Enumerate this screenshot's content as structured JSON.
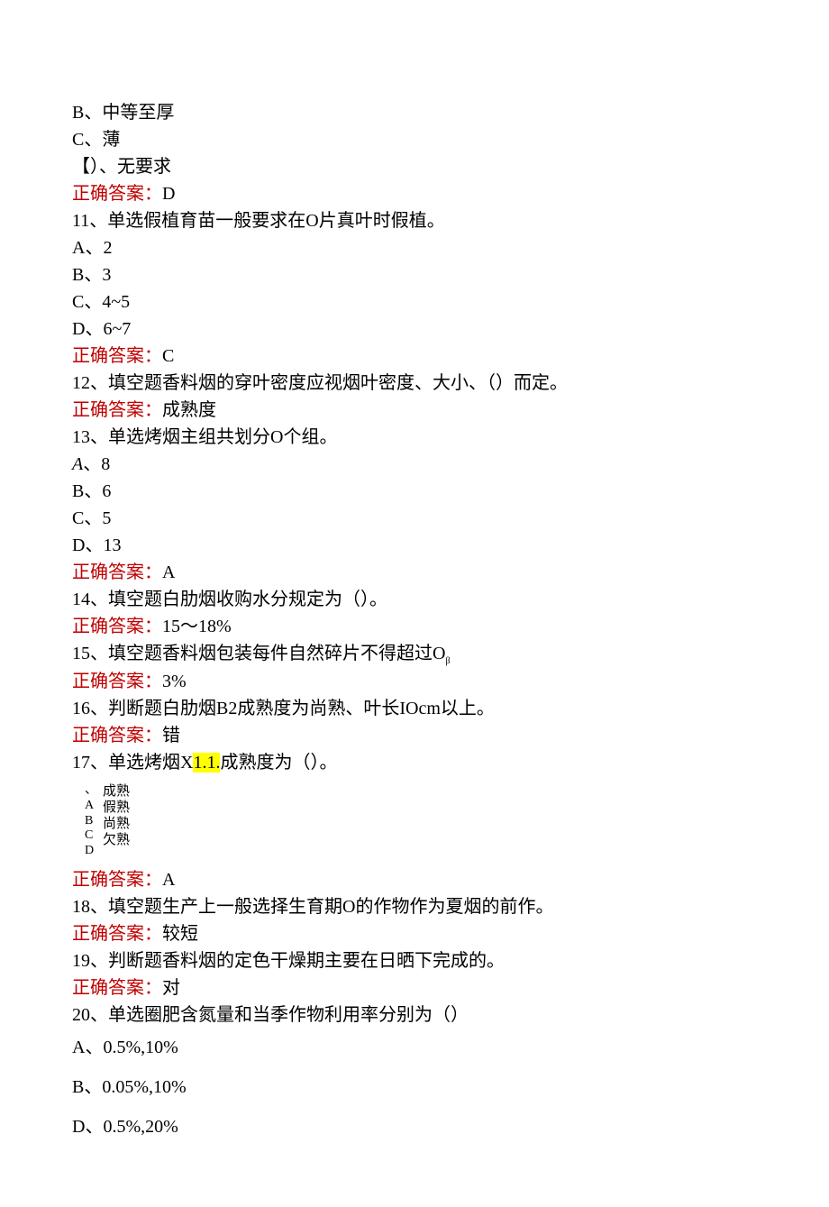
{
  "q10": {
    "optB": "B、中等至厚",
    "optC": "C、薄",
    "optD": "【）、无要求",
    "answer": "D"
  },
  "q11": {
    "text": "11、单选假植育苗一般要求在O片真叶时假植。",
    "optA": "A、2",
    "optB": "B、3",
    "optC": "C、4~5",
    "optD": "D、6~7",
    "answer": "C"
  },
  "q12": {
    "text": "12、填空题香料烟的穿叶密度应视烟叶密度、大小、（）而定。",
    "answer": "成熟度"
  },
  "q13": {
    "text": "13、单选烤烟主组共划分O个组。",
    "optA_label": "A",
    "optA_val": "、8",
    "optB": "B、6",
    "optC": "C、5",
    "optD": "D、13",
    "answer": "A"
  },
  "q14": {
    "text": "14、填空题白肋烟收购水分规定为（）。",
    "answer": "15～18%"
  },
  "q15": {
    "text_a": "15、填空题香料烟包装每件自然碎片不得超过O",
    "text_b": "β",
    "answer": "3%"
  },
  "q16": {
    "text": "16、判断题白肋烟B2成熟度为尚熟、叶长IOcm以上。",
    "answer": "错"
  },
  "q17": {
    "text_a": "17、单选烤烟X",
    "text_hl": "1.1.",
    "text_b": "成熟度为（）。",
    "labels": [
      "、",
      "A",
      "B",
      "C",
      "D"
    ],
    "options": [
      "成熟",
      "假熟",
      "尚熟",
      "欠熟"
    ],
    "answer": "A"
  },
  "q18": {
    "text": "18、填空题生产上一般选择生育期O的作物作为夏烟的前作。",
    "answer": "较短"
  },
  "q19": {
    "text": "19、判断题香料烟的定色干燥期主要在日晒下完成的。",
    "answer": "对"
  },
  "q20": {
    "text": "20、单选圈肥含氮量和当季作物利用率分别为（）",
    "optA": "A、0.5%,10%",
    "optB": "B、0.05%,10%",
    "optD": "D、0.5%,20%"
  },
  "labels": {
    "correct_answer": "正确答案："
  }
}
